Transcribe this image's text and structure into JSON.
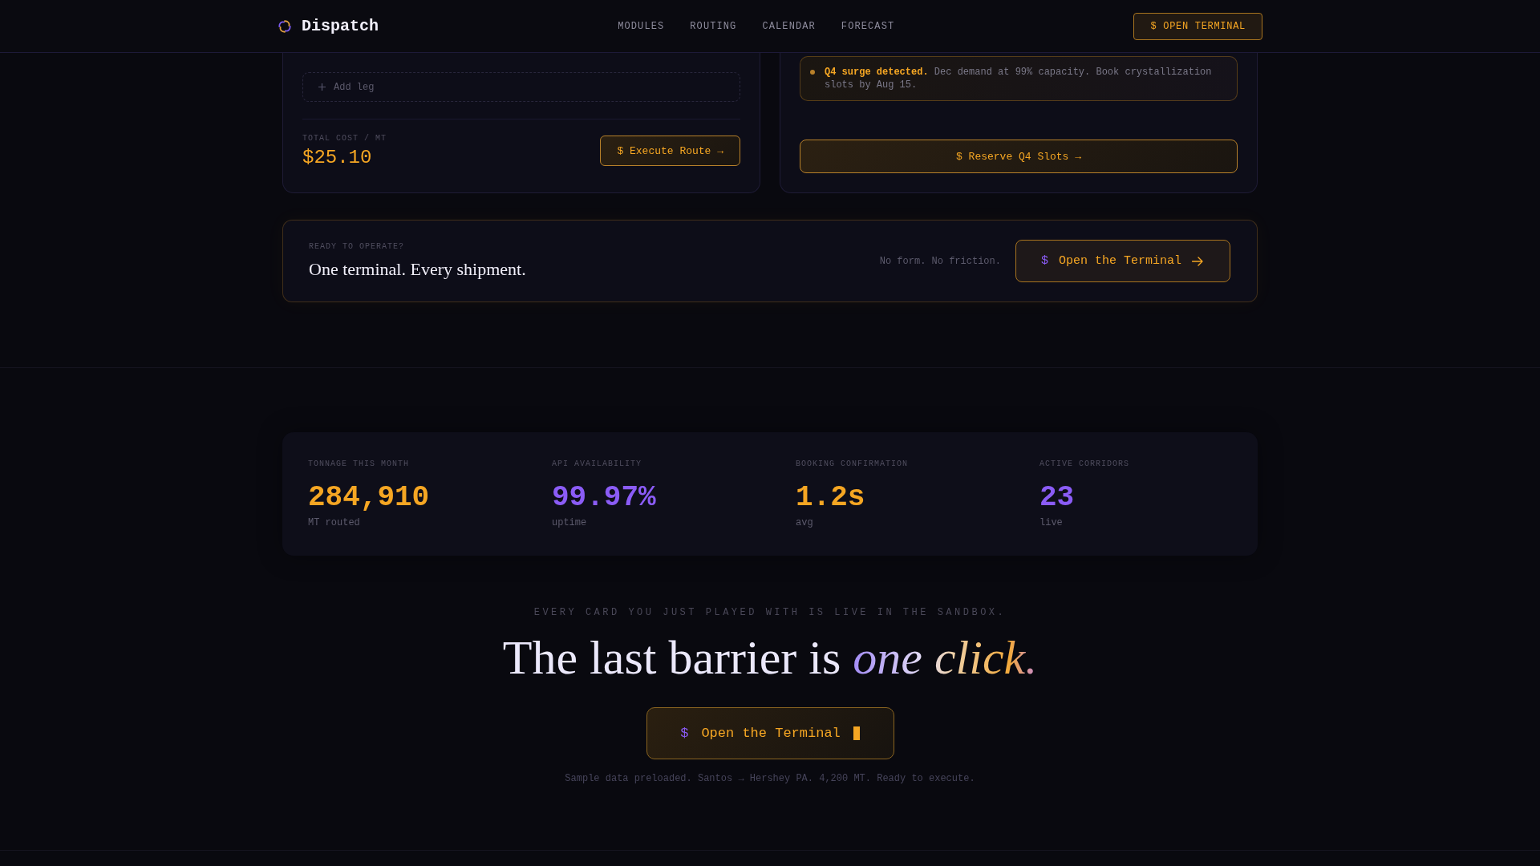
{
  "header": {
    "brand": "Dispatch",
    "nav": [
      "MODULES",
      "ROUTING",
      "CALENDAR",
      "FORECAST"
    ],
    "button": "$ OPEN TERMINAL"
  },
  "route_card": {
    "add_leg": "Add leg",
    "total_label": "TOTAL COST / MT",
    "total_value": "$25.10",
    "button": "$ Execute Route →"
  },
  "forecast_card": {
    "alert": "**Q4 surge detected.** Dec demand at 99% capacity. Book crystallization slots by Aug 15.",
    "button": "$ Reserve Q4 Slots →"
  },
  "banner": {
    "eyebrow": "READY TO OPERATE?",
    "title": "One terminal. Every shipment.",
    "note": "No form. No friction.",
    "button": {
      "prompt": "$",
      "label": "Open the Terminal"
    }
  },
  "stats": [
    {
      "label": "TONNAGE THIS MONTH",
      "value": "284,910",
      "caption": "MT routed",
      "color": "#f5a623"
    },
    {
      "label": "API AVAILABILITY",
      "value": "99.97%",
      "caption": "uptime",
      "color": "#8b5cf6"
    },
    {
      "label": "BOOKING CONFIRMATION",
      "value": "1.2s",
      "caption": "avg",
      "color": "#f5a623"
    },
    {
      "label": "ACTIVE CORRIDORS",
      "value": "23",
      "caption": "live",
      "color": "#8b5cf6"
    }
  ],
  "closing": {
    "eyebrow": "EVERY CARD YOU JUST PLAYED WITH IS LIVE IN THE SANDBOX.",
    "headline": "The last barrier is *one click.*",
    "button": {
      "prompt": "$",
      "label": "Open the Terminal"
    },
    "footnote": "Sample data preloaded. Santos → Hershey PA. 4,200 MT. Ready to execute."
  }
}
